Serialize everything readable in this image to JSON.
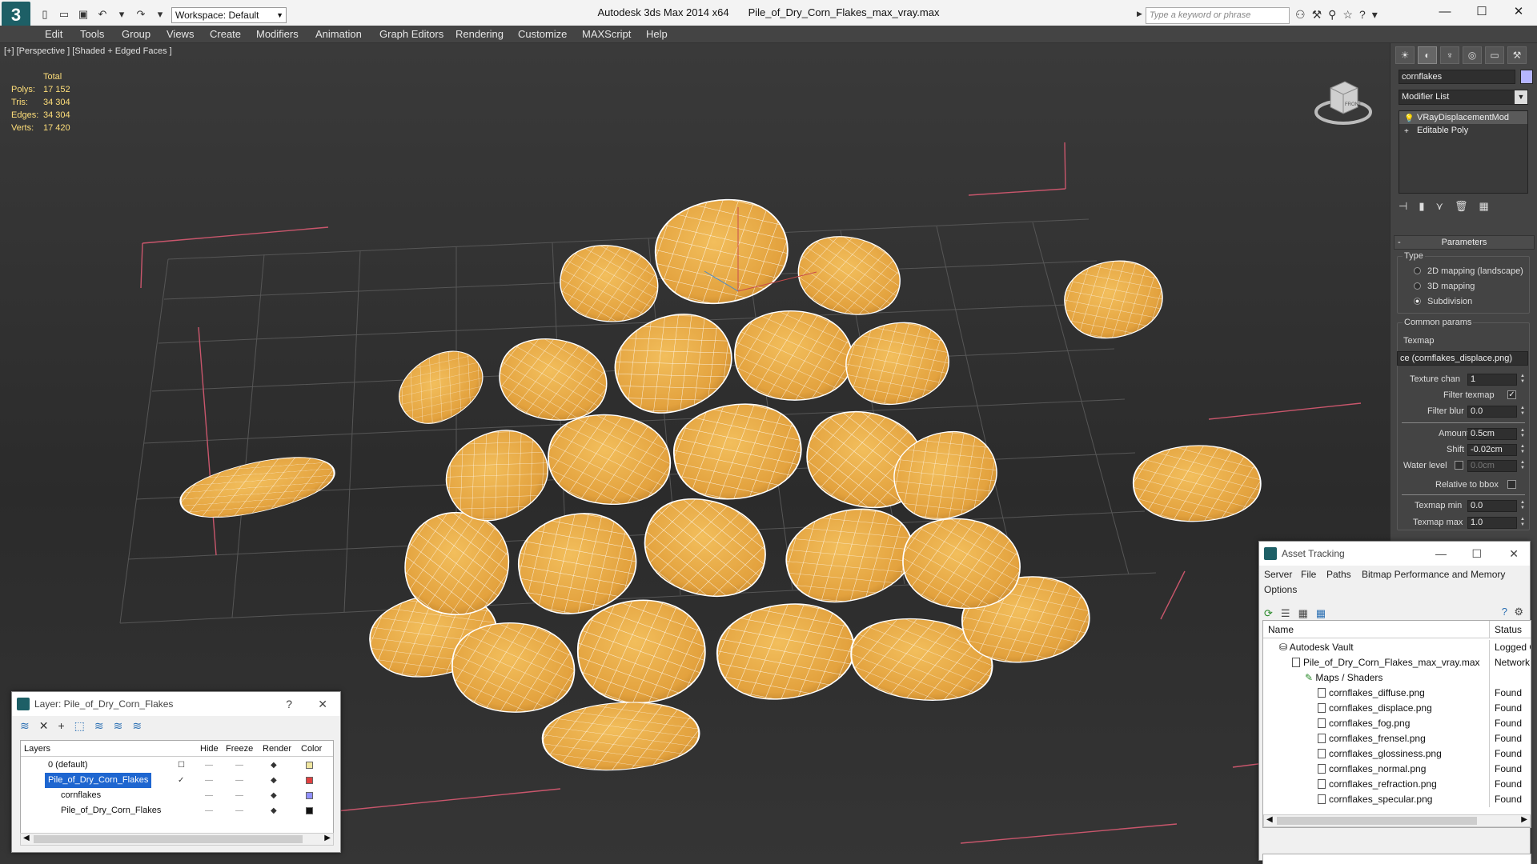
{
  "title": {
    "app": "Autodesk 3ds Max  2014 x64",
    "file": "Pile_of_Dry_Corn_Flakes_max_vray.max"
  },
  "workspace": "Workspace: Default",
  "search_placeholder": "Type a keyword or phrase",
  "menu": [
    "Edit",
    "Tools",
    "Group",
    "Views",
    "Create",
    "Modifiers",
    "Animation",
    "Graph Editors",
    "Rendering",
    "Customize",
    "MAXScript",
    "Help"
  ],
  "viewport": {
    "label": "[+] [Perspective ] [Shaded + Edged Faces ]",
    "stats": {
      "header": "Total",
      "rows": [
        {
          "k": "Polys:",
          "v": "17 152"
        },
        {
          "k": "Tris:",
          "v": "34 304"
        },
        {
          "k": "Edges:",
          "v": "34 304"
        },
        {
          "k": "Verts:",
          "v": "17 420"
        }
      ]
    },
    "viewcube_label": "FRONT"
  },
  "colors": {
    "flake": "#e5a642",
    "wire": "#ffffff",
    "grid": "#565656",
    "bound": "#c9566c",
    "object": "#b5b5ff"
  },
  "command_panel": {
    "object_name": "cornflakes",
    "modifier_list": "Modifier List",
    "stack": [
      "VRayDisplacementMod",
      "Editable Poly"
    ],
    "rollout": "Parameters",
    "type_group": "Type",
    "type_options": [
      "2D mapping (landscape)",
      "3D mapping",
      "Subdivision"
    ],
    "common_group": "Common params",
    "texmap_label": "Texmap",
    "texmap_value": "ce (cornflakes_displace.png)",
    "texture_chan": {
      "label": "Texture chan",
      "value": "1"
    },
    "filter_texmap": "Filter texmap",
    "filter_blur": {
      "label": "Filter blur",
      "value": "0.0"
    },
    "amount": {
      "label": "Amount",
      "value": "0.5cm"
    },
    "shift": {
      "label": "Shift",
      "value": "-0.02cm"
    },
    "water_level": {
      "label": "Water level",
      "value": "0.0cm"
    },
    "relative_bbox": "Relative to bbox",
    "texmap_min": {
      "label": "Texmap min",
      "value": "0.0"
    },
    "texmap_max": {
      "label": "Texmap max",
      "value": "1.0"
    }
  },
  "layer_dialog": {
    "title": "Layer: Pile_of_Dry_Corn_Flakes",
    "columns": [
      "Layers",
      "Hide",
      "Freeze",
      "Render",
      "Color"
    ],
    "rows": [
      {
        "name": "0 (default)",
        "color": "#f0e6a0"
      },
      {
        "name": "Pile_of_Dry_Corn_Flakes",
        "color": "#e04040"
      },
      {
        "name": "cornflakes",
        "color": "#9090ff"
      },
      {
        "name": "Pile_of_Dry_Corn_Flakes",
        "color": "#111111"
      }
    ]
  },
  "asset_tracking": {
    "title": "Asset Tracking",
    "menu": [
      "Server",
      "File",
      "Paths",
      "Bitmap Performance and Memory",
      "Options"
    ],
    "columns": [
      "Name",
      "Status"
    ],
    "rows": [
      {
        "name": "Autodesk Vault",
        "status": "Logged O"
      },
      {
        "name": "Pile_of_Dry_Corn_Flakes_max_vray.max",
        "status": "Network P"
      },
      {
        "name": "Maps / Shaders",
        "status": ""
      },
      {
        "name": "cornflakes_diffuse.png",
        "status": "Found"
      },
      {
        "name": "cornflakes_displace.png",
        "status": "Found"
      },
      {
        "name": "cornflakes_fog.png",
        "status": "Found"
      },
      {
        "name": "cornflakes_frensel.png",
        "status": "Found"
      },
      {
        "name": "cornflakes_glossiness.png",
        "status": "Found"
      },
      {
        "name": "cornflakes_normal.png",
        "status": "Found"
      },
      {
        "name": "cornflakes_refraction.png",
        "status": "Found"
      },
      {
        "name": "cornflakes_specular.png",
        "status": "Found"
      }
    ]
  }
}
